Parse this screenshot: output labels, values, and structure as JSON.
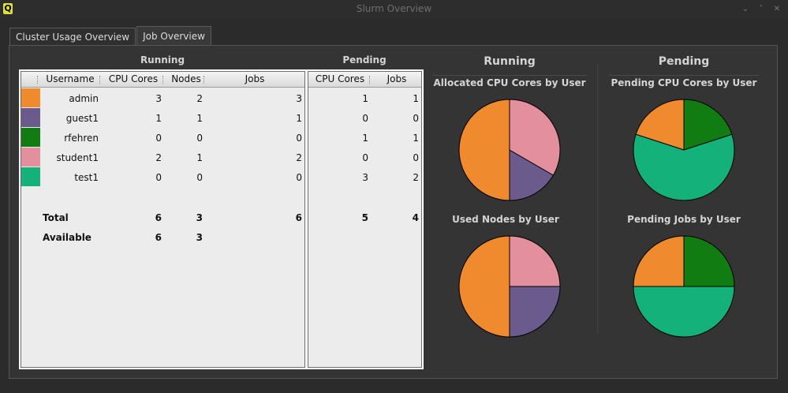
{
  "window": {
    "title": "Slurm Overview",
    "app_icon_glyph": "Q",
    "controls": [
      "minimize-icon",
      "maximize-icon",
      "close-icon"
    ],
    "control_glyphs": [
      "⌄",
      "˄",
      "✕"
    ]
  },
  "tabs": [
    {
      "label": "Cluster Usage Overview",
      "active": false
    },
    {
      "label": "Job Overview",
      "active": true
    }
  ],
  "sections": {
    "running_table_title": "Running",
    "pending_table_title": "Pending",
    "running_charts_title": "Running",
    "pending_charts_title": "Pending"
  },
  "running_table": {
    "headers": {
      "username": "Username",
      "cpu_cores": "CPU Cores",
      "nodes": "Nodes",
      "jobs": "Jobs"
    }
  },
  "pending_table": {
    "headers": {
      "cpu_cores": "CPU Cores",
      "jobs": "Jobs"
    }
  },
  "users": [
    {
      "name": "admin",
      "color": "#ef8a2f",
      "running": {
        "cpu": "3",
        "nodes": "2",
        "jobs": "3"
      },
      "pending": {
        "cpu": "1",
        "jobs": "1"
      }
    },
    {
      "name": "guest1",
      "color": "#6a5b8c",
      "running": {
        "cpu": "1",
        "nodes": "1",
        "jobs": "1"
      },
      "pending": {
        "cpu": "0",
        "jobs": "0"
      }
    },
    {
      "name": "rfehren",
      "color": "#117c11",
      "running": {
        "cpu": "0",
        "nodes": "0",
        "jobs": "0"
      },
      "pending": {
        "cpu": "1",
        "jobs": "1"
      }
    },
    {
      "name": "student1",
      "color": "#e48f9d",
      "running": {
        "cpu": "2",
        "nodes": "1",
        "jobs": "2"
      },
      "pending": {
        "cpu": "0",
        "jobs": "0"
      }
    },
    {
      "name": "test1",
      "color": "#14b27a",
      "running": {
        "cpu": "0",
        "nodes": "0",
        "jobs": "0"
      },
      "pending": {
        "cpu": "3",
        "jobs": "2"
      }
    }
  ],
  "totals": {
    "label": "Total",
    "running": {
      "cpu": "6",
      "nodes": "3",
      "jobs": "6"
    },
    "pending": {
      "cpu": "5",
      "jobs": "4"
    }
  },
  "available": {
    "label": "Available",
    "running": {
      "cpu": "6",
      "nodes": "3"
    }
  },
  "chart_data": [
    {
      "type": "pie",
      "title": "Allocated CPU Cores by User",
      "labels": [
        "admin",
        "guest1",
        "student1"
      ],
      "values": [
        3,
        1,
        2
      ],
      "colors": [
        "#ef8a2f",
        "#6a5b8c",
        "#e48f9d"
      ]
    },
    {
      "type": "pie",
      "title": "Pending CPU Cores by User",
      "labels": [
        "admin",
        "test1",
        "rfehren"
      ],
      "values": [
        1,
        3,
        1
      ],
      "colors": [
        "#ef8a2f",
        "#14b27a",
        "#117c11"
      ]
    },
    {
      "type": "pie",
      "title": "Used Nodes by User",
      "labels": [
        "admin",
        "guest1",
        "student1"
      ],
      "values": [
        2,
        1,
        1
      ],
      "colors": [
        "#ef8a2f",
        "#6a5b8c",
        "#e48f9d"
      ]
    },
    {
      "type": "pie",
      "title": "Pending Jobs by User",
      "labels": [
        "admin",
        "test1",
        "rfehren"
      ],
      "values": [
        1,
        2,
        1
      ],
      "colors": [
        "#ef8a2f",
        "#14b27a",
        "#117c11"
      ]
    }
  ]
}
